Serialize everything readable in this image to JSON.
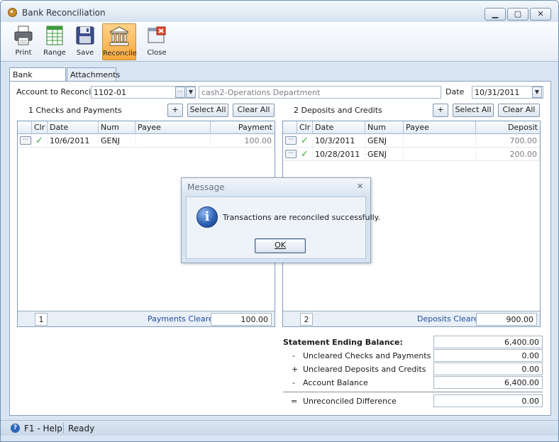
{
  "window": {
    "title": "Bank Reconciliation",
    "minimize": "▁",
    "restore": "▢",
    "close": "✕"
  },
  "toolbar": {
    "print": "Print",
    "range": "Range",
    "save": "Save",
    "reconcile": "Reconcile",
    "close": "Close"
  },
  "tabs": [
    {
      "label": "Bank Accounts"
    },
    {
      "label": "Attachments"
    }
  ],
  "account": {
    "label": "Account to Reconcile",
    "value": "1102-01",
    "description": "cash2-Operations Department",
    "ellipsis": "···",
    "dropdown": "▼",
    "date_label": "Date",
    "date_value": "10/31/2011"
  },
  "checks": {
    "title": "1  Checks and Payments",
    "add": "+",
    "select_all": "Select All",
    "clear_all": "Clear All",
    "columns": {
      "clr": "Clr",
      "date": "Date",
      "num": "Num",
      "payee": "Payee",
      "amount": "Payment"
    },
    "rows": [
      {
        "ellipsis": "···",
        "check": "✓",
        "date": "10/6/2011",
        "num": "GENJ",
        "payee": "",
        "amount": "100.00"
      }
    ],
    "footer_count": "1",
    "footer_label": "Payments Cleared",
    "footer_total": "100.00"
  },
  "deposits": {
    "title": "2  Deposits and Credits",
    "add": "+",
    "select_all": "Select All",
    "clear_all": "Clear All",
    "columns": {
      "clr": "Clr",
      "date": "Date",
      "num": "Num",
      "payee": "Payee",
      "amount": "Deposit"
    },
    "rows": [
      {
        "ellipsis": "···",
        "check": "✓",
        "date": "10/3/2011",
        "num": "GENJ",
        "payee": "",
        "amount": "700.00"
      },
      {
        "ellipsis": "···",
        "check": "✓",
        "date": "10/28/2011",
        "num": "GENJ",
        "payee": "",
        "amount": "200.00"
      }
    ],
    "footer_count": "2",
    "footer_label": "Deposits Cleared",
    "footer_total": "900.00"
  },
  "summary": {
    "statement_label": "Statement Ending Balance:",
    "statement_value": "6,400.00",
    "uncleared_checks_sign": "-",
    "uncleared_checks_label": "Uncleared Checks and Payments",
    "uncleared_checks_value": "0.00",
    "uncleared_deposits_sign": "+",
    "uncleared_deposits_label": "Uncleared Deposits and Credits",
    "uncleared_deposits_value": "0.00",
    "account_balance_sign": "-",
    "account_balance_label": "Account Balance",
    "account_balance_value": "6,400.00",
    "difference_sign": "=",
    "difference_label": "Unreconciled Difference",
    "difference_value": "0.00"
  },
  "status": {
    "help": "F1 - Help",
    "state": "Ready"
  },
  "dialog": {
    "title": "Message",
    "close": "✕",
    "icon": "i",
    "message": "Transactions are reconciled successfully.",
    "ok": "OK"
  }
}
